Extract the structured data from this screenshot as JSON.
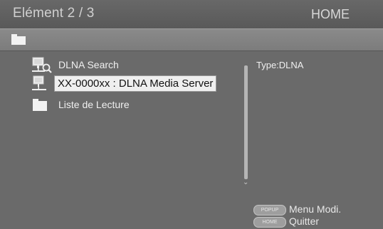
{
  "header": {
    "title": "Elément 2 / 3",
    "home_label": "HOME"
  },
  "pathbar": {
    "icon": "folder-icon"
  },
  "items": [
    {
      "label": "DLNA Search",
      "icon": "network-search-icon"
    },
    {
      "label": "XX-0000xx : DLNA Media Server",
      "icon": "media-server-icon",
      "selected": true
    },
    {
      "label": "Liste de Lecture",
      "icon": "folder-icon"
    }
  ],
  "info": {
    "type_text": "Type:DLNA"
  },
  "legend": [
    {
      "key": "POPUP",
      "label": "Menu Modi."
    },
    {
      "key": "HOME",
      "label": "Quitter"
    }
  ],
  "colors": {
    "background": "#6a6a6a",
    "selection": "#efefef"
  }
}
